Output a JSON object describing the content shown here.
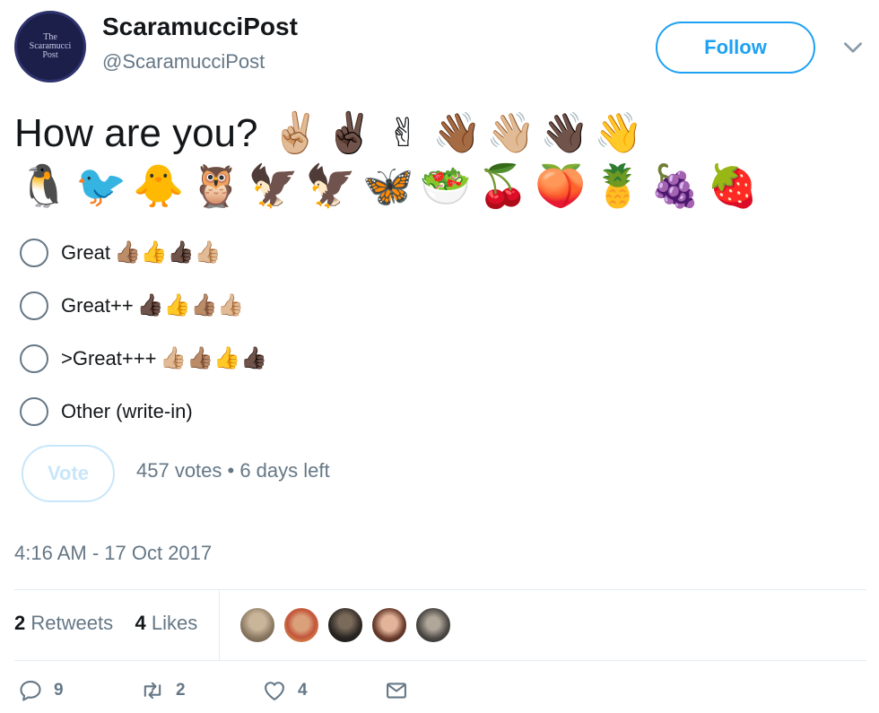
{
  "user": {
    "display_name": "ScaramucciPost",
    "handle": "@ScaramucciPost",
    "avatar_text": "The\nScaramucci\nPost"
  },
  "follow_label": "Follow",
  "tweet": {
    "text": "How are you?",
    "inline_emoji": [
      "✌🏼",
      "✌🏿",
      "✌",
      "👋🏾",
      "👋🏼",
      "👋🏿",
      "👋"
    ],
    "emoji_row": [
      "🐧",
      "🐦",
      "🐥",
      "🦉",
      "🦅",
      "🦅",
      "🦋",
      "🥗",
      "🍒",
      "🍑",
      "🍍",
      "🍇",
      "🍓"
    ]
  },
  "poll": {
    "options": [
      {
        "label": "Great",
        "emoji": "👍🏽👍👍🏿👍🏼"
      },
      {
        "label": "Great++",
        "emoji": "👍🏿👍👍🏽👍🏼"
      },
      {
        "label": ">Great+++",
        "emoji": "👍🏼👍🏽👍👍🏿"
      },
      {
        "label": "Other (write-in)",
        "emoji": ""
      }
    ],
    "vote_label": "Vote",
    "meta": "457 votes • 6 days left"
  },
  "timestamp": "4:16 AM - 17 Oct 2017",
  "stats": {
    "retweets_count": "2",
    "retweets_label": "Retweets",
    "likes_count": "4",
    "likes_label": "Likes"
  },
  "actions": {
    "reply_count": "9",
    "retweet_count": "2",
    "like_count": "4"
  },
  "colors": {
    "accent": "#1da1f2",
    "secondary_text": "#657786",
    "primary_text": "#14171a",
    "divider": "#e6ecf0"
  },
  "icons": [
    "caret-down-icon",
    "reply-icon",
    "retweet-icon",
    "heart-icon",
    "message-icon"
  ]
}
